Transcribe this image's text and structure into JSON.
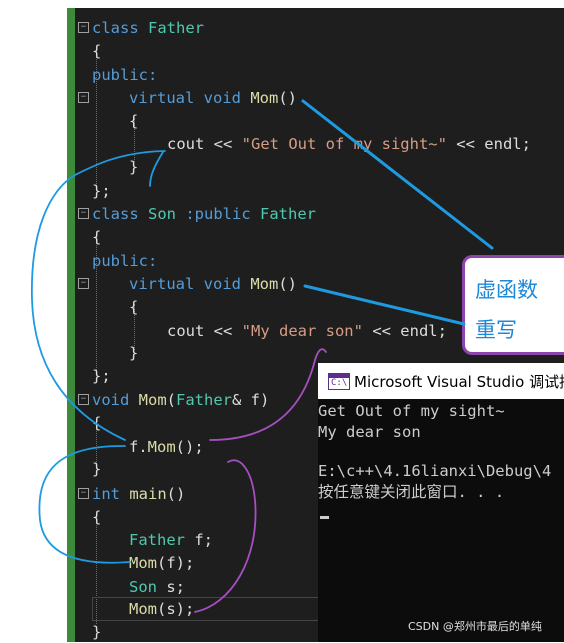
{
  "code": {
    "l1": {
      "kw": "class",
      "name": "Father"
    },
    "l2": {
      "text": "{"
    },
    "l3": {
      "text": "public:"
    },
    "l4": {
      "kw1": "virtual",
      "kw2": "void",
      "fn": "Mom",
      "rest": "()"
    },
    "l5": {
      "text": "{"
    },
    "l6": {
      "a": "cout << ",
      "str": "\"Get Out of my sight~\"",
      "b": " << endl;"
    },
    "l7": {
      "text": "}"
    },
    "l8": {
      "text": "};"
    },
    "l9": {
      "kw": "class",
      "name": "Son",
      "mid": " :public ",
      "base": "Father"
    },
    "l10": {
      "text": "{"
    },
    "l11": {
      "text": "public:"
    },
    "l12": {
      "kw1": "virtual",
      "kw2": "void",
      "fn": "Mom",
      "rest": "()"
    },
    "l13": {
      "text": "{"
    },
    "l14": {
      "a": "cout << ",
      "str": "\"My dear son\"",
      "b": " << endl;"
    },
    "l15": {
      "text": "}"
    },
    "l16": {
      "text": "};"
    },
    "l17": {
      "kw": "void",
      "fn": "Mom",
      "p1": "(",
      "ty": "Father",
      "p2": "& f)"
    },
    "l18": {
      "text": "{"
    },
    "l19": {
      "a": "f.",
      "fn": "Mom",
      "b": "();"
    },
    "l20": {
      "text": "}"
    },
    "l21": {
      "kw": "int",
      "fn": "main",
      "rest": "()"
    },
    "l22": {
      "text": "{"
    },
    "l23": {
      "ty": "Father",
      "rest": " f;"
    },
    "l24": {
      "fn": "Mom",
      "rest": "(f);"
    },
    "l25": {
      "ty": "Son",
      "rest": " s;"
    },
    "l26": {
      "fn": "Mom",
      "rest": "(s);"
    },
    "l27": {
      "text": "}"
    }
  },
  "fold_glyph": "−",
  "callout": {
    "line1": "虚函数",
    "line2": "重写"
  },
  "console": {
    "title": "Microsoft Visual Studio 调试控",
    "icon": "C:\\",
    "lines": [
      "Get Out of my sight~",
      "My dear son",
      "",
      "E:\\c++\\4.16lianxi\\Debug\\4",
      "按任意键关闭此窗口. . ."
    ]
  },
  "watermark": "CSDN @郑州市最后的单纯",
  "colors": {
    "keyword": "#569cd6",
    "type": "#4ec9b0",
    "function": "#dcdcaa",
    "string": "#d69d85",
    "annotation_blue": "#1e9be0",
    "annotation_purple": "#a64fc0",
    "callout_border": "#8d44ad"
  }
}
